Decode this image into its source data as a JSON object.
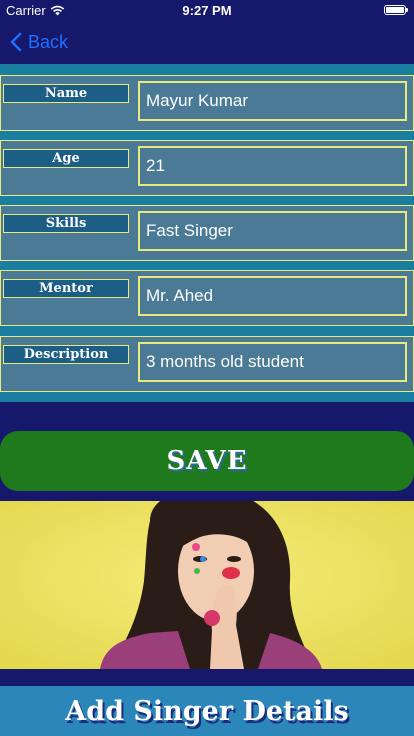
{
  "status_bar": {
    "carrier": "Carrier",
    "time": "9:27 PM",
    "icons": [
      "wifi-icon",
      "battery-icon"
    ]
  },
  "nav": {
    "back_label": "Back",
    "back_icon": "chevron-left-icon"
  },
  "form": {
    "fields": [
      {
        "label": "Name",
        "value": "Mayur Kumar"
      },
      {
        "label": "Age",
        "value": "21"
      },
      {
        "label": "Skills",
        "value": "Fast Singer"
      },
      {
        "label": "Mentor",
        "value": "Mr. Ahed"
      },
      {
        "label": "Description",
        "value": "3 months old student"
      }
    ]
  },
  "save_label": "SAVE",
  "banner_title": "Add Singer Details",
  "colors": {
    "background": "#16196b",
    "accent": "#1e6eff",
    "field_border": "#e8ea7a",
    "save_button": "#1e7a1c",
    "banner": "#2b86b9"
  }
}
